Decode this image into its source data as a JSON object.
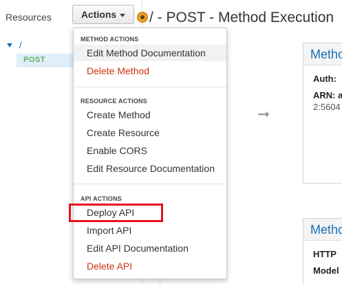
{
  "left_pane": {
    "resources_label": "Resources",
    "tree_root": "/",
    "tree_method": "POST"
  },
  "actions_button": {
    "label": "Actions"
  },
  "header": {
    "title": "/ - POST - Method Execution"
  },
  "dropdown": {
    "method_actions": {
      "heading": "METHOD ACTIONS",
      "items": [
        "Edit Method Documentation",
        "Delete Method"
      ]
    },
    "resource_actions": {
      "heading": "RESOURCE ACTIONS",
      "items": [
        "Create Method",
        "Create Resource",
        "Enable CORS",
        "Edit Resource Documentation"
      ]
    },
    "api_actions": {
      "heading": "API ACTIONS",
      "items": [
        "Deploy API",
        "Import API",
        "Edit API Documentation",
        "Delete API"
      ]
    }
  },
  "cards": {
    "card1": {
      "title": "Metho",
      "auth_label": "Auth:",
      "arn_label": "ARN: a",
      "arn_value": "2:5604"
    },
    "card2": {
      "title": "Metho",
      "http_label": "HTTP",
      "model_label": "Model"
    }
  },
  "colors": {
    "accent": "#1a6fb3",
    "danger": "#d13212",
    "highlight": "#e8101f",
    "method_post": "#5fb15f",
    "selected_bg": "#dfeefb"
  },
  "icons": {
    "tree_caret": "caret-down-icon",
    "actions_caret": "chevron-down-icon",
    "method_dot": "method-status-icon",
    "flow_arrow": "arrow-right-icon"
  }
}
